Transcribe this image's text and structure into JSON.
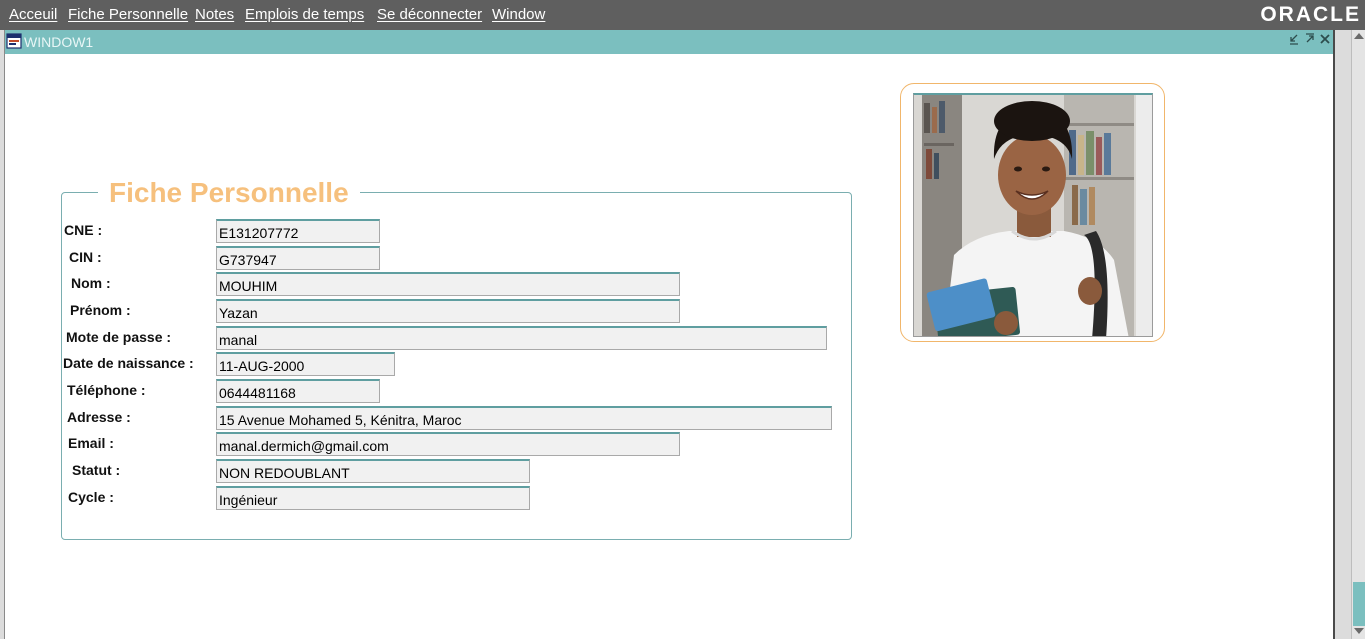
{
  "menu": {
    "items": [
      "Acceuil",
      "Fiche Personnelle",
      "Notes",
      "Emplois de temps",
      "Se déconnecter",
      "Window"
    ],
    "brand": "ORACLE"
  },
  "window": {
    "title": "WINDOW1",
    "controls": [
      "minimize-icon",
      "restore-icon",
      "close-icon"
    ]
  },
  "form": {
    "title": "Fiche Personnelle",
    "fields": [
      {
        "label": "CNE :",
        "value": "E131207772"
      },
      {
        "label": "CIN :",
        "value": "G737947"
      },
      {
        "label": "Nom :",
        "value": "MOUHIM"
      },
      {
        "label": "Prénom :",
        "value": "Yazan"
      },
      {
        "label": "Mote de passe :",
        "value": "manal"
      },
      {
        "label": "Date de naissance :",
        "value": "11-AUG-2000"
      },
      {
        "label": "Téléphone :",
        "value": "0644481168"
      },
      {
        "label": "Adresse :",
        "value": "15 Avenue Mohamed 5, Kénitra, Maroc"
      },
      {
        "label": "Email :",
        "value": "manal.dermich@gmail.com"
      },
      {
        "label": "Statut :",
        "value": "NON REDOUBLANT"
      },
      {
        "label": "Cycle :",
        "value": "Ingénieur"
      }
    ]
  },
  "colors": {
    "menubar": "#5f5f5f",
    "titlebar": "#7bbfbf",
    "form_title": "#f6c07d",
    "photo_border": "#f1b66b"
  }
}
